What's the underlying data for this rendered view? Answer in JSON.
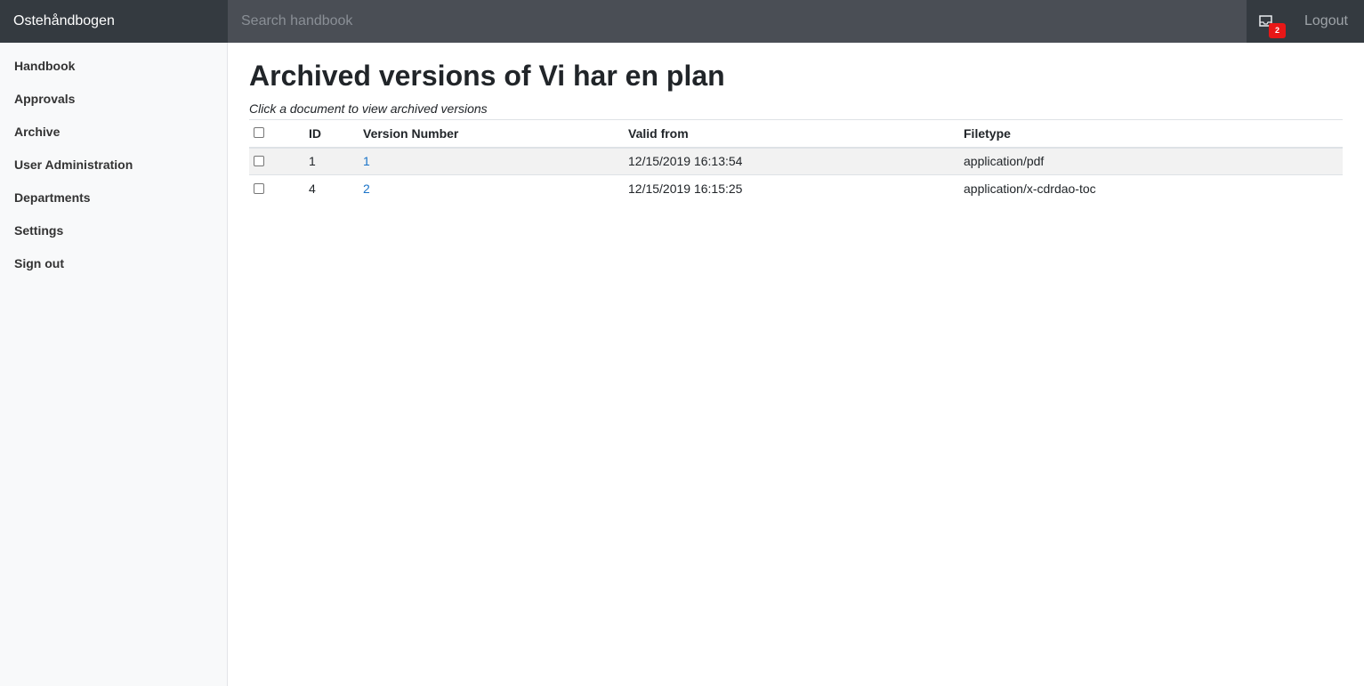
{
  "topbar": {
    "brand": "Ostehåndbogen",
    "search_placeholder": "Search handbook",
    "notification_count": "2",
    "logout_label": "Logout"
  },
  "sidebar": {
    "items": [
      {
        "label": "Handbook"
      },
      {
        "label": "Approvals"
      },
      {
        "label": "Archive"
      },
      {
        "label": "User Administration"
      },
      {
        "label": "Departments"
      },
      {
        "label": "Settings"
      },
      {
        "label": "Sign out"
      }
    ]
  },
  "main": {
    "title": "Archived versions of Vi har en plan",
    "hint": "Click a document to view archived versions",
    "table": {
      "headers": {
        "id": "ID",
        "version": "Version Number",
        "valid_from": "Valid from",
        "filetype": "Filetype"
      },
      "rows": [
        {
          "id": "1",
          "version": "1",
          "valid_from": "12/15/2019 16:13:54",
          "filetype": "application/pdf"
        },
        {
          "id": "4",
          "version": "2",
          "valid_from": "12/15/2019 16:15:25",
          "filetype": "application/x-cdrdao-toc"
        }
      ]
    }
  },
  "colors": {
    "topbar_dark": "#343a40",
    "search_bg": "#4a4e55",
    "badge": "#e81717",
    "link": "#1a73c8",
    "sidebar_bg": "#f8f9fa"
  }
}
